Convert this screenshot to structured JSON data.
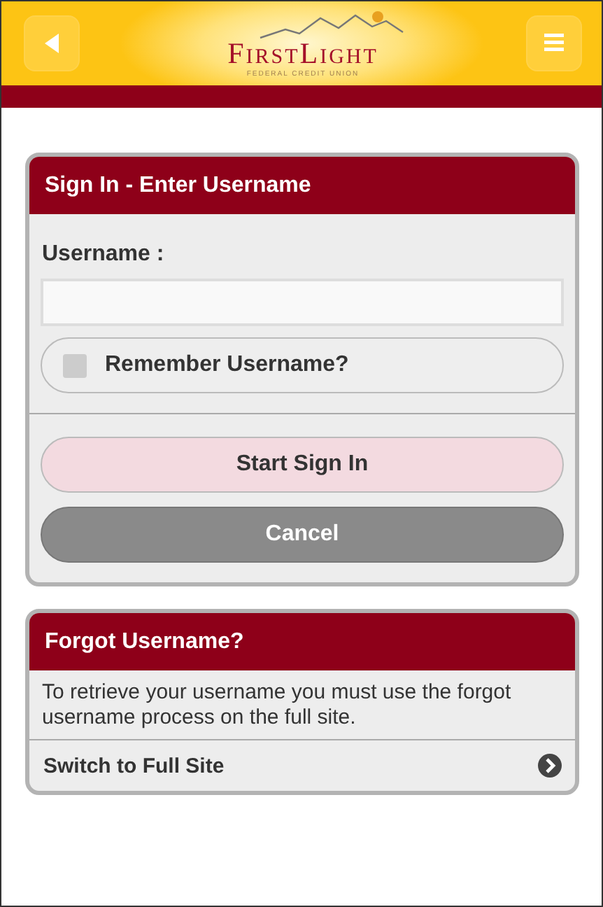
{
  "header": {
    "logo": {
      "name": "FirstLight",
      "tagline": "FEDERAL CREDIT UNION"
    }
  },
  "sign_in": {
    "title": "Sign In - Enter Username",
    "username_label": "Username :",
    "remember": {
      "label": "Remember Username?",
      "checked": false
    },
    "buttons": [
      {
        "label": "Start Sign In",
        "kind": "primary"
      },
      {
        "label": "Cancel",
        "kind": "secondary"
      }
    ]
  },
  "forgot": {
    "title": "Forgot Username?",
    "text": "To retrieve your username you must use the forgot username process on the full site.",
    "link": "Switch to Full Site"
  }
}
